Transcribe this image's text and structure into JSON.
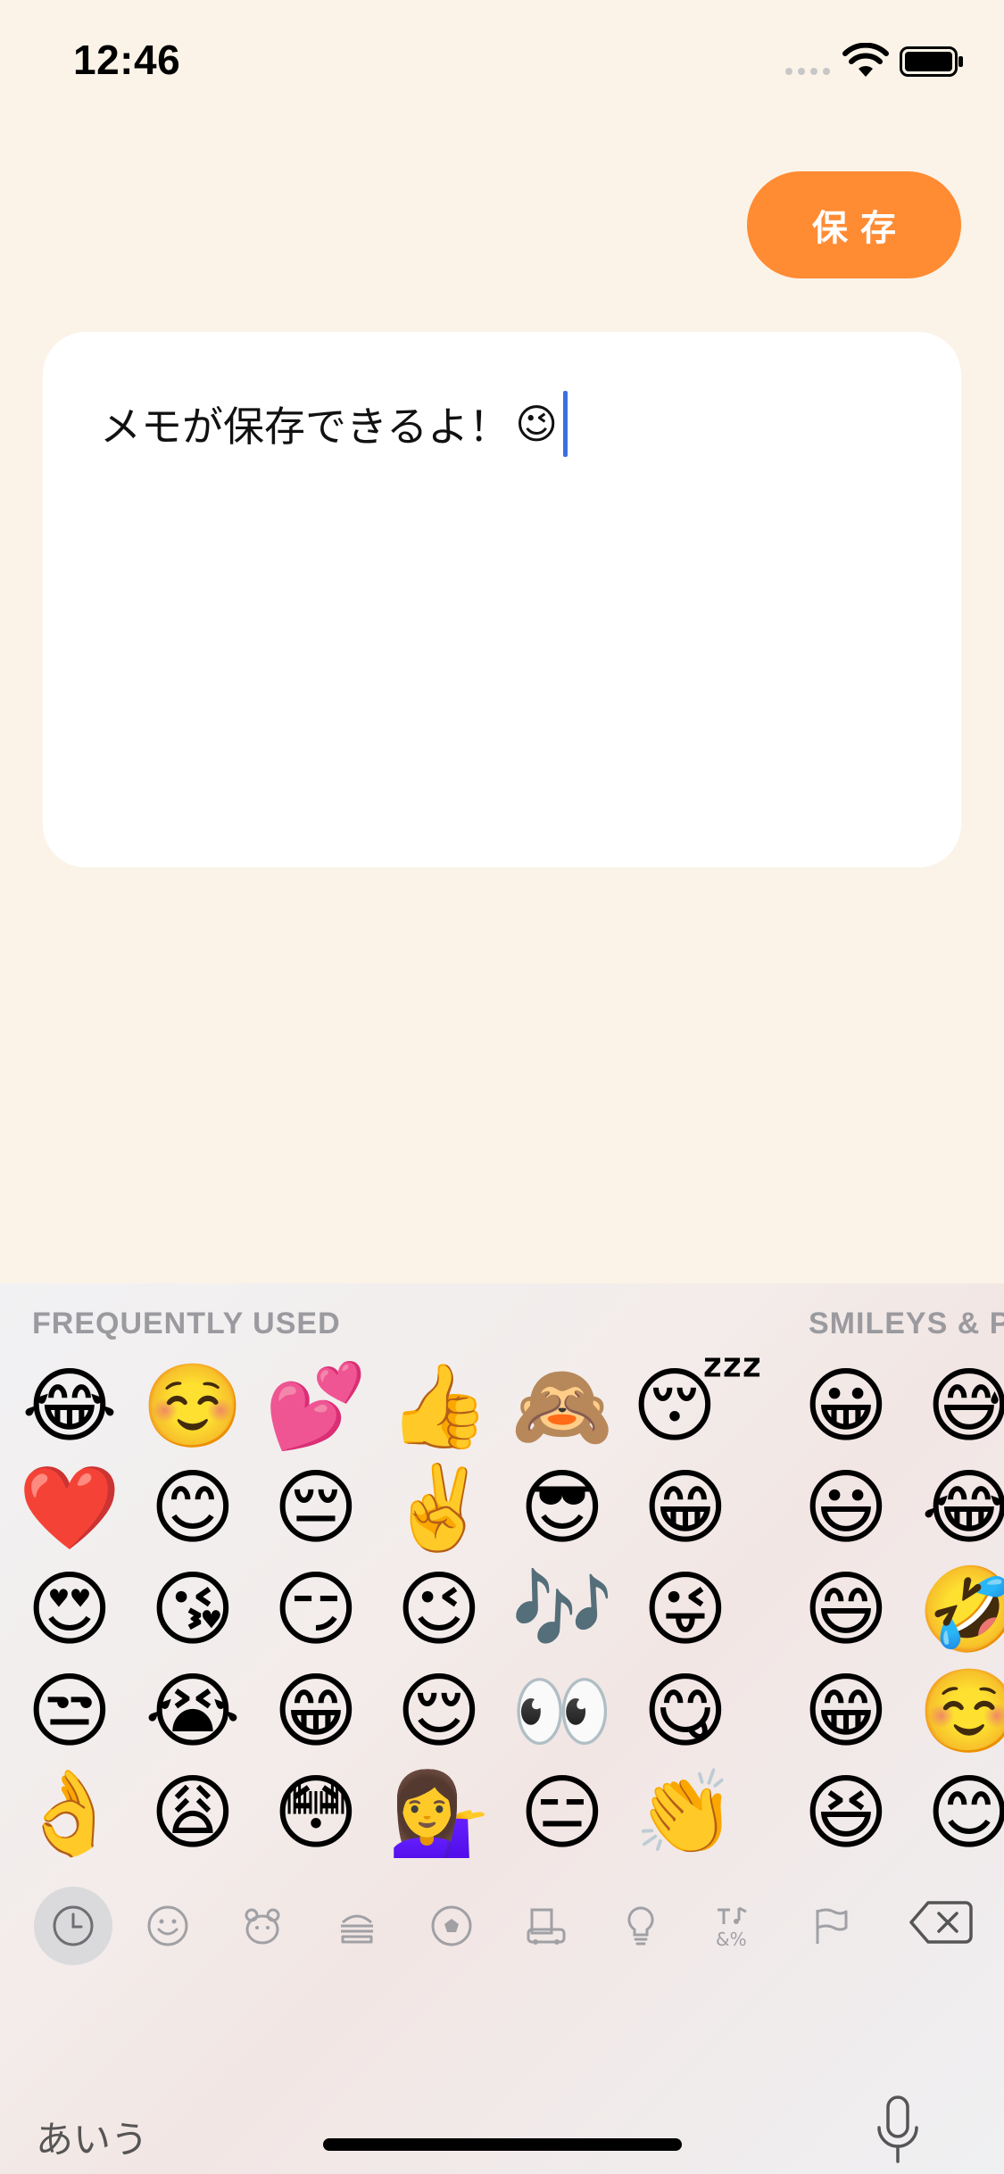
{
  "status_bar": {
    "time": "12:46",
    "icons": [
      "signal-icon",
      "wifi-icon",
      "battery-icon"
    ]
  },
  "header": {
    "save_label": "保存"
  },
  "memo": {
    "text": "メモが保存できるよ！",
    "emoji": "😉"
  },
  "keyboard": {
    "sections": {
      "frequently_used": "FREQUENTLY USED",
      "smileys": "SMILEYS & P"
    },
    "frequently_used": [
      [
        "😂",
        "☺️",
        "💕",
        "👍",
        "🙈",
        "😴"
      ],
      [
        "❤️",
        "😊",
        "😔",
        "✌️",
        "😎",
        "😁"
      ],
      [
        "😍",
        "😘",
        "😏",
        "😉",
        "🎶",
        "😜"
      ],
      [
        "😒",
        "😭",
        "😁",
        "😌",
        "👀",
        "😋"
      ],
      [
        "👌",
        "😩",
        "😳",
        "💁‍♀️",
        "😑",
        "👏"
      ]
    ],
    "smileys": [
      [
        "😀",
        "😅"
      ],
      [
        "😃",
        "😂"
      ],
      [
        "😄",
        "🤣"
      ],
      [
        "😁",
        "☺️"
      ],
      [
        "😆",
        "😊"
      ]
    ],
    "categories": [
      "recent-icon",
      "smiley-icon",
      "animal-icon",
      "food-icon",
      "sports-icon",
      "travel-icon",
      "objects-icon",
      "symbols-icon",
      "flags-icon"
    ],
    "kana_label": "あいう",
    "accent": "#FF8B33",
    "caret_color": "#3A6FE2"
  }
}
